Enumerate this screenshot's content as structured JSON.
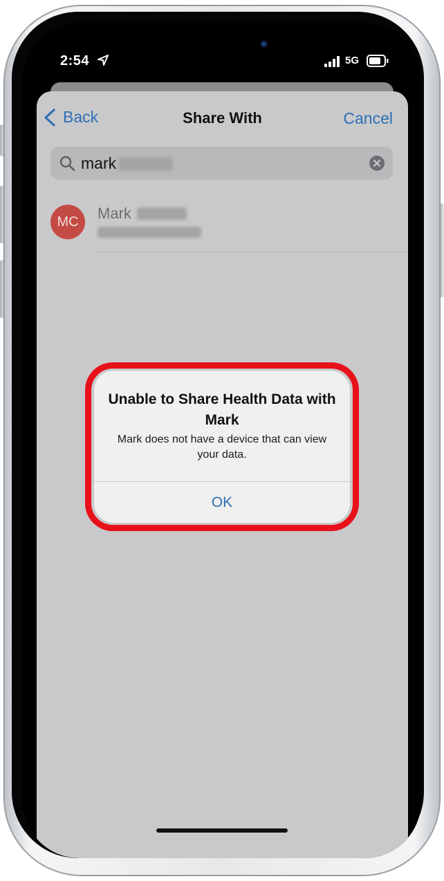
{
  "status_bar": {
    "time": "2:54",
    "network": "5G"
  },
  "nav": {
    "back_label": "Back",
    "title": "Share With",
    "cancel_label": "Cancel"
  },
  "search": {
    "value": "mark"
  },
  "contact": {
    "initials": "MC",
    "name": "Mark"
  },
  "alert": {
    "title": "Unable to Share Health Data with Mark",
    "message": "Mark does not have a device that can view your data.",
    "ok_label": "OK"
  },
  "colors": {
    "accent_blue": "#2d6fb5",
    "highlight_red": "#e8101a",
    "avatar_red": "#c44a44",
    "sheet_gray": "#c9c9cb"
  },
  "icons": {
    "location": "location-arrow-icon",
    "signal": "cellular-signal-icon",
    "battery": "battery-icon",
    "back": "chevron-left-icon",
    "search": "magnifying-glass-icon",
    "clear": "clear-circle-icon"
  }
}
